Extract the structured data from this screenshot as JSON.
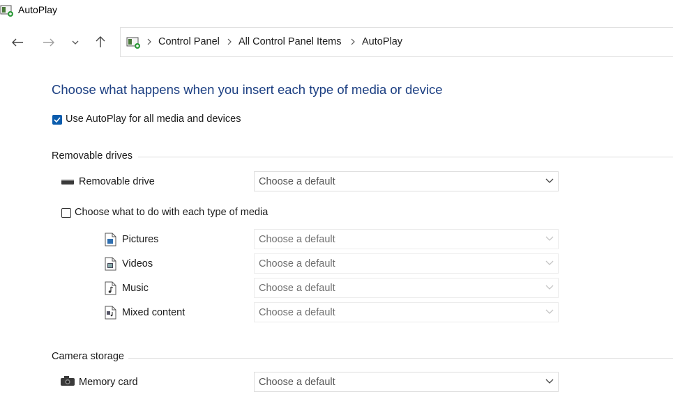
{
  "window": {
    "title": "AutoPlay"
  },
  "breadcrumb": [
    "Control Panel",
    "All Control Panel Items",
    "AutoPlay"
  ],
  "heading": "Choose what happens when you insert each type of media or device",
  "use_autoplay": {
    "label": "Use AutoPlay for all media and devices",
    "checked": true
  },
  "removable": {
    "group_title": "Removable drives",
    "drive_label": "Removable drive",
    "drive_value": "Choose a default",
    "per_media_label": "Choose what to do with each type of media",
    "per_media_checked": false,
    "media": [
      {
        "label": "Pictures",
        "value": "Choose a default"
      },
      {
        "label": "Videos",
        "value": "Choose a default"
      },
      {
        "label": "Music",
        "value": "Choose a default"
      },
      {
        "label": "Mixed content",
        "value": "Choose a default"
      }
    ]
  },
  "camera": {
    "group_title": "Camera storage",
    "memory_card_label": "Memory card",
    "memory_card_value": "Choose a default"
  },
  "colors": {
    "heading": "#1c3f82",
    "checkbox_accent": "#0b5cad"
  },
  "icons": {
    "app": "autoplay-app-icon",
    "back": "back-arrow-icon",
    "forward": "forward-arrow-icon",
    "recent": "chevron-down-icon",
    "up": "up-arrow-icon",
    "separator": "chevron-right-icon",
    "drive": "removable-drive-icon",
    "pictures": "pictures-file-icon",
    "videos": "video-file-icon",
    "music": "music-file-icon",
    "mixed": "mixed-content-file-icon",
    "camera": "camera-icon"
  }
}
